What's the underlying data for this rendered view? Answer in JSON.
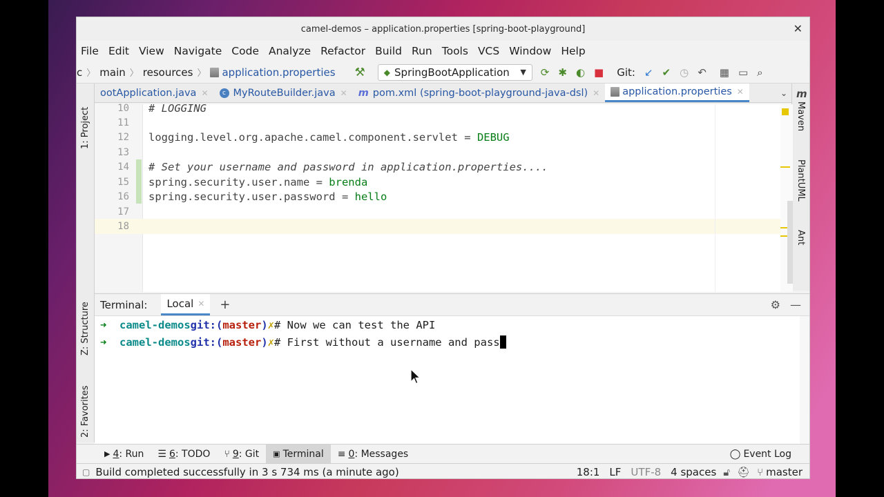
{
  "window": {
    "title": "camel-demos – application.properties [spring-boot-playground]"
  },
  "menu": [
    "File",
    "Edit",
    "View",
    "Navigate",
    "Code",
    "Analyze",
    "Refactor",
    "Build",
    "Run",
    "Tools",
    "VCS",
    "Window",
    "Help"
  ],
  "breadcrumb": {
    "prefix": "c",
    "items": [
      "main",
      "resources",
      "application.properties"
    ]
  },
  "run_config": "SpringBootApplication",
  "git_label": "Git:",
  "tabs": [
    {
      "label": "ootApplication.java"
    },
    {
      "label": "MyRouteBuilder.java"
    },
    {
      "label": "pom.xml (spring-boot-playground-java-dsl)"
    },
    {
      "label": "application.properties"
    }
  ],
  "side_left": {
    "project": "1: Project",
    "structure": "Z: Structure",
    "favorites": "2: Favorites"
  },
  "side_right": {
    "maven": "Maven",
    "plantuml": "PlantUML",
    "ant": "Ant"
  },
  "editor": {
    "lines": [
      {
        "n": "10",
        "text": "# LOGGING"
      },
      {
        "n": "11",
        "text": ""
      },
      {
        "n": "12",
        "key": "logging.level.org.apache.camel.component.servlet",
        "val": "DEBUG"
      },
      {
        "n": "13",
        "text": ""
      },
      {
        "n": "14",
        "text": "# Set your username and password in application.properties...."
      },
      {
        "n": "15",
        "key": "spring.security.user.name",
        "val": "brenda"
      },
      {
        "n": "16",
        "key": "spring.security.user.password",
        "val": "hello"
      },
      {
        "n": "17",
        "text": ""
      },
      {
        "n": "18",
        "text": ""
      }
    ]
  },
  "terminal": {
    "label": "Terminal:",
    "tab": "Local",
    "lines": [
      {
        "dir": "camel-demos",
        "git": "git:(",
        "branch": "master",
        "close": ")",
        "cmd": "# Now we can test the API"
      },
      {
        "dir": "camel-demos",
        "git": "git:(",
        "branch": "master",
        "close": ")",
        "cmd": "# First without a username and pass"
      }
    ]
  },
  "toolwindows": [
    {
      "num": "4",
      "label": ": Run"
    },
    {
      "num": "6",
      "label": ": TODO"
    },
    {
      "num": "9",
      "label": ": Git"
    },
    {
      "label": "Terminal"
    },
    {
      "num": "0",
      "label": ": Messages"
    }
  ],
  "event_log": "Event Log",
  "status": {
    "message": "Build completed successfully in 3 s 734 ms (a minute ago)",
    "position": "18:1",
    "line_sep": "LF",
    "encoding": "UTF-8",
    "indent": "4 spaces",
    "branch": "master"
  }
}
